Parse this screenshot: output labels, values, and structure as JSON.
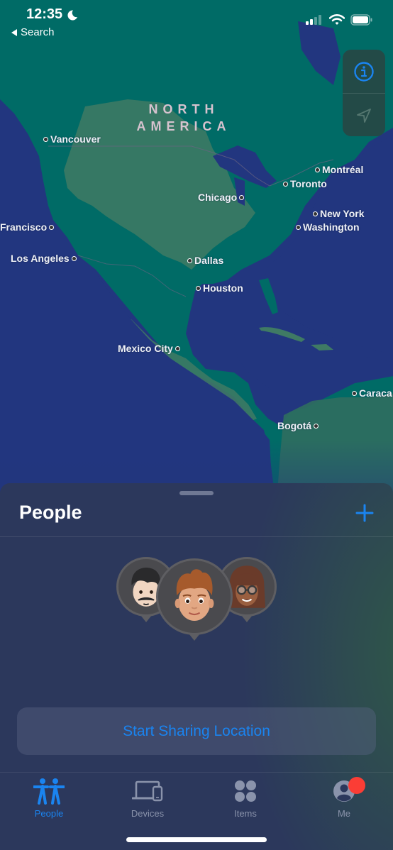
{
  "status_bar": {
    "time": "12:35",
    "focus_icon": "moon-icon",
    "back_label": "Search",
    "signal_icon": "cellular-signal-icon",
    "wifi_icon": "wifi-icon",
    "battery_icon": "battery-icon"
  },
  "map": {
    "continent_label_line1": "NORTH",
    "continent_label_line2": "AMERICA",
    "cities": [
      {
        "name": "Vancouver"
      },
      {
        "name": "Montréal"
      },
      {
        "name": "Toronto"
      },
      {
        "name": "Chicago"
      },
      {
        "name": "New York"
      },
      {
        "name": "Washington"
      },
      {
        "name": "Francisco"
      },
      {
        "name": "Los Angeles"
      },
      {
        "name": "Dallas"
      },
      {
        "name": "Houston"
      },
      {
        "name": "Mexico City"
      },
      {
        "name": "Caraca"
      },
      {
        "name": "Bogotá"
      }
    ],
    "controls": {
      "info_icon": "info-icon",
      "location_icon": "location-arrow-icon"
    }
  },
  "sheet": {
    "title": "People",
    "add_icon": "plus-icon",
    "avatars": [
      {
        "label": "memoji-man-dark-hair-mustache"
      },
      {
        "label": "memoji-boy-auburn-hair"
      },
      {
        "label": "memoji-woman-glasses"
      }
    ],
    "share_button_label": "Start Sharing Location"
  },
  "tabbar": {
    "tabs": [
      {
        "label": "People",
        "icon": "people-icon",
        "active": true
      },
      {
        "label": "Devices",
        "icon": "devices-icon",
        "active": false
      },
      {
        "label": "Items",
        "icon": "items-icon",
        "active": false
      },
      {
        "label": "Me",
        "icon": "me-icon",
        "active": false,
        "badge": true
      }
    ]
  },
  "colors": {
    "accent": "#1A84F0",
    "ocean": "#22367F",
    "land": "#006B66",
    "land_light": "#3F7A64",
    "badge": "#FB3D35",
    "sheet": "#2C385C"
  }
}
